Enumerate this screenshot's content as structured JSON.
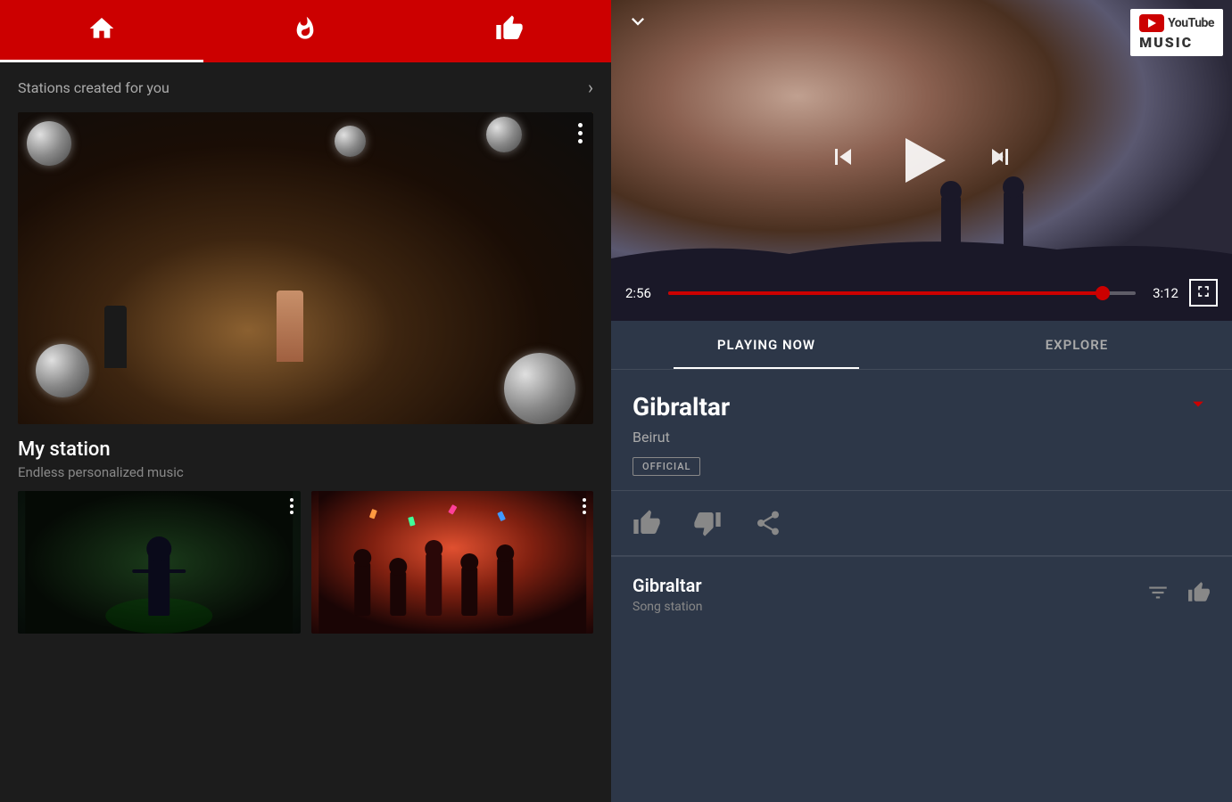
{
  "app": {
    "title": "YouTube Music"
  },
  "left_panel": {
    "nav": {
      "items": [
        {
          "id": "home",
          "label": "Home",
          "icon": "home",
          "active": true
        },
        {
          "id": "trending",
          "label": "Trending",
          "icon": "fire",
          "active": false
        },
        {
          "id": "liked",
          "label": "Liked",
          "icon": "thumbs-up",
          "active": false
        }
      ]
    },
    "stations_header": {
      "label": "Stations created for you",
      "chevron": "›"
    },
    "main_card": {
      "title": "My station",
      "subtitle": "Endless personalized music"
    },
    "thumbnails": [
      {
        "id": "thumb1",
        "alt": "Artist in dark scene"
      },
      {
        "id": "thumb2",
        "alt": "Party crowd scene"
      }
    ]
  },
  "right_panel": {
    "player": {
      "chevron_down": "˅",
      "current_time": "2:56",
      "total_time": "3:12",
      "progress_percent": 93
    },
    "logo": {
      "youtube_text": "You",
      "tube_text": "Tube",
      "music_text": "MuSiC"
    },
    "tabs": [
      {
        "id": "playing-now",
        "label": "PLAYING NOW",
        "active": true
      },
      {
        "id": "explore",
        "label": "EXPLORE",
        "active": false
      }
    ],
    "song": {
      "title": "Gibraltar",
      "artist": "Beirut",
      "badge": "OFFICIAL"
    },
    "actions": {
      "like_label": "Like",
      "dislike_label": "Dislike",
      "share_label": "Share"
    },
    "queue": {
      "title": "Gibraltar",
      "subtitle": "Song station"
    }
  }
}
